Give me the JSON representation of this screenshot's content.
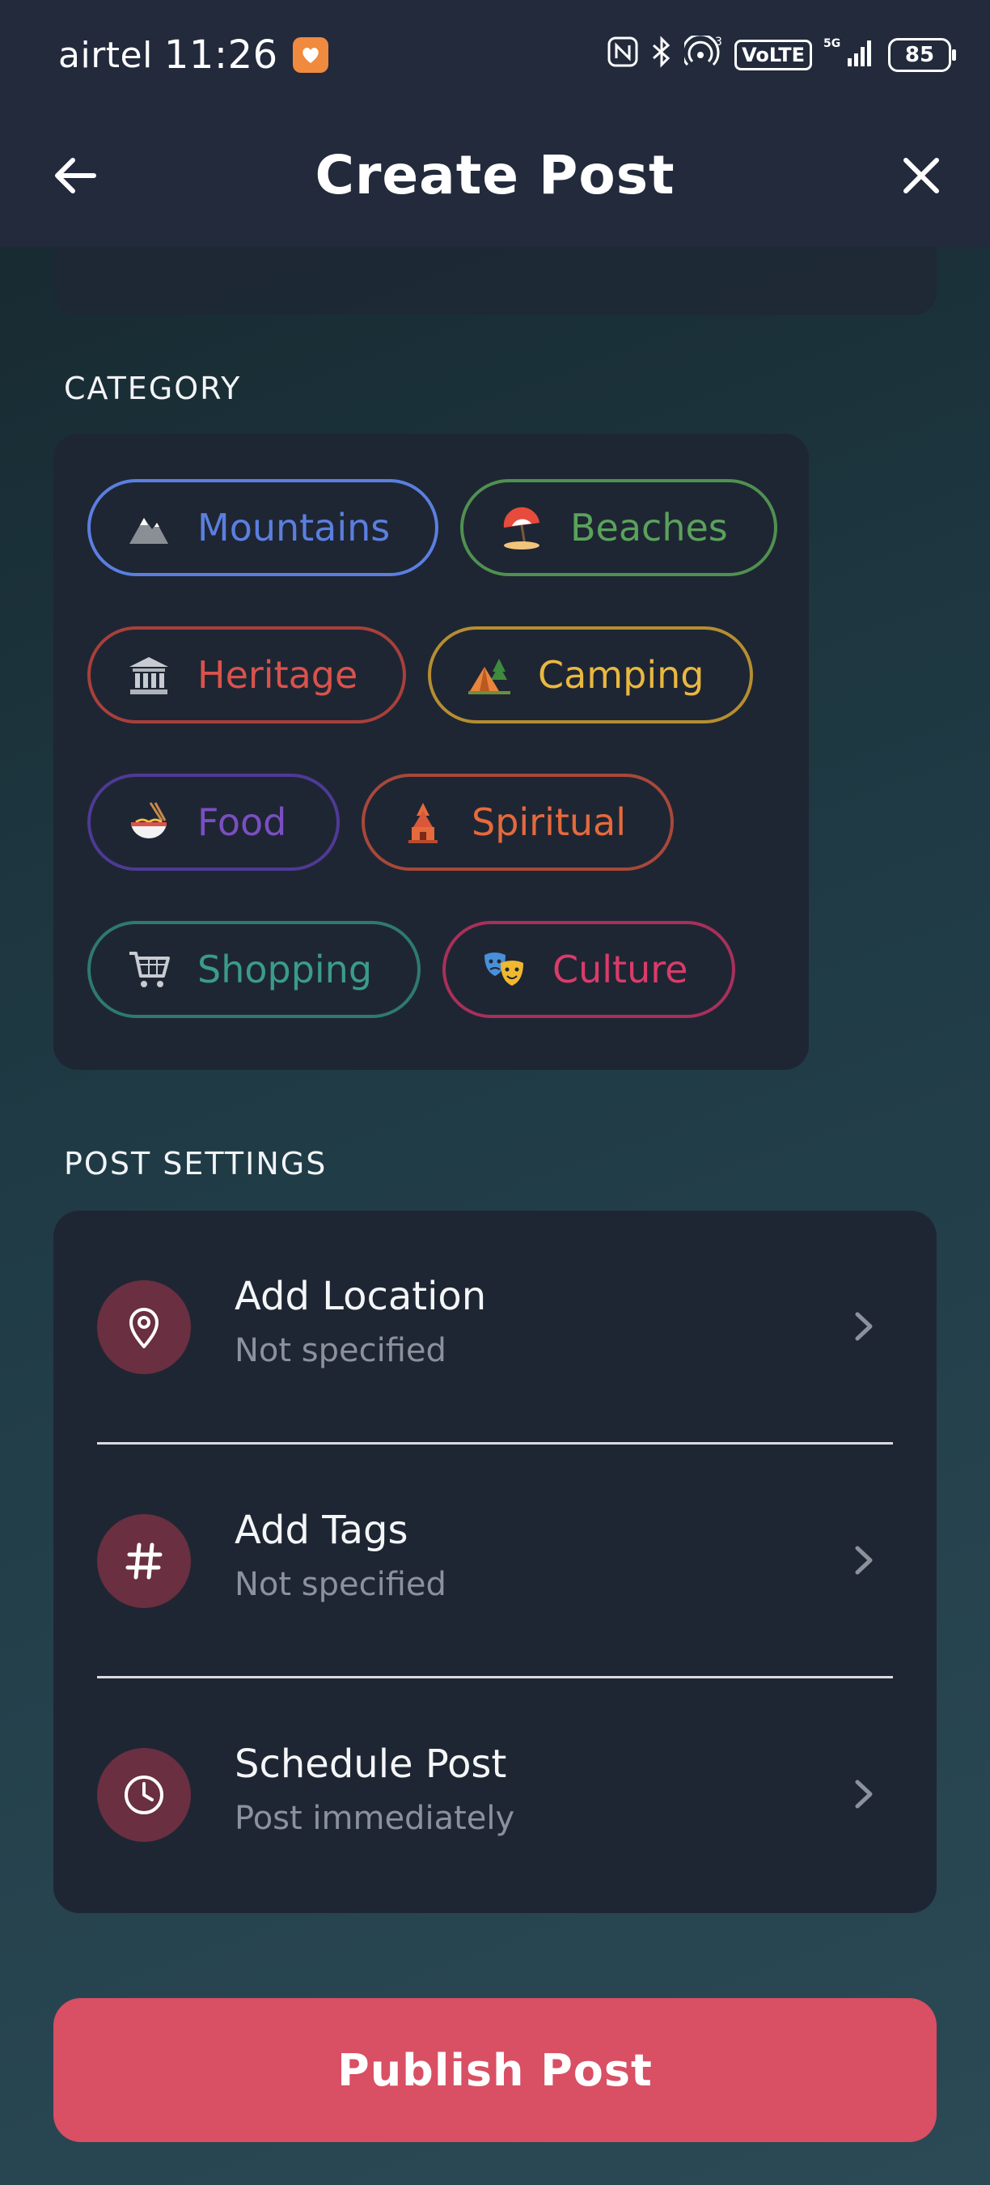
{
  "status_bar": {
    "carrier": "airtel",
    "time": "11:26",
    "network": "5G",
    "volte": "VoLTE",
    "battery": "85"
  },
  "header": {
    "title": "Create Post"
  },
  "category": {
    "label": "CATEGORY",
    "chips": [
      {
        "label": "Mountains",
        "icon": "mountain-icon",
        "color": "#5b7fe0"
      },
      {
        "label": "Beaches",
        "icon": "beach-umbrella-icon",
        "color": "#5aa25c"
      },
      {
        "label": "Heritage",
        "icon": "classical-building-icon",
        "color": "#d9534c"
      },
      {
        "label": "Camping",
        "icon": "tent-icon",
        "color": "#e9b840"
      },
      {
        "label": "Food",
        "icon": "noodle-bowl-icon",
        "color": "#7a4fc2"
      },
      {
        "label": "Spiritual",
        "icon": "temple-icon",
        "color": "#e56a3c"
      },
      {
        "label": "Shopping",
        "icon": "shopping-cart-icon",
        "color": "#3a9c8a"
      },
      {
        "label": "Culture",
        "icon": "theater-masks-icon",
        "color": "#d93c6b"
      }
    ]
  },
  "post_settings": {
    "label": "POST SETTINGS",
    "items": [
      {
        "title": "Add Location",
        "subtitle": "Not specified",
        "icon": "location-pin-icon"
      },
      {
        "title": "Add Tags",
        "subtitle": "Not specified",
        "icon": "hashtag-icon"
      },
      {
        "title": "Schedule Post",
        "subtitle": "Post immediately",
        "icon": "clock-icon"
      }
    ]
  },
  "publish_label": "Publish Post",
  "colors": {
    "accent": "#d94f63",
    "icon_circle": "#6a2f40",
    "card": "#1f2633"
  }
}
